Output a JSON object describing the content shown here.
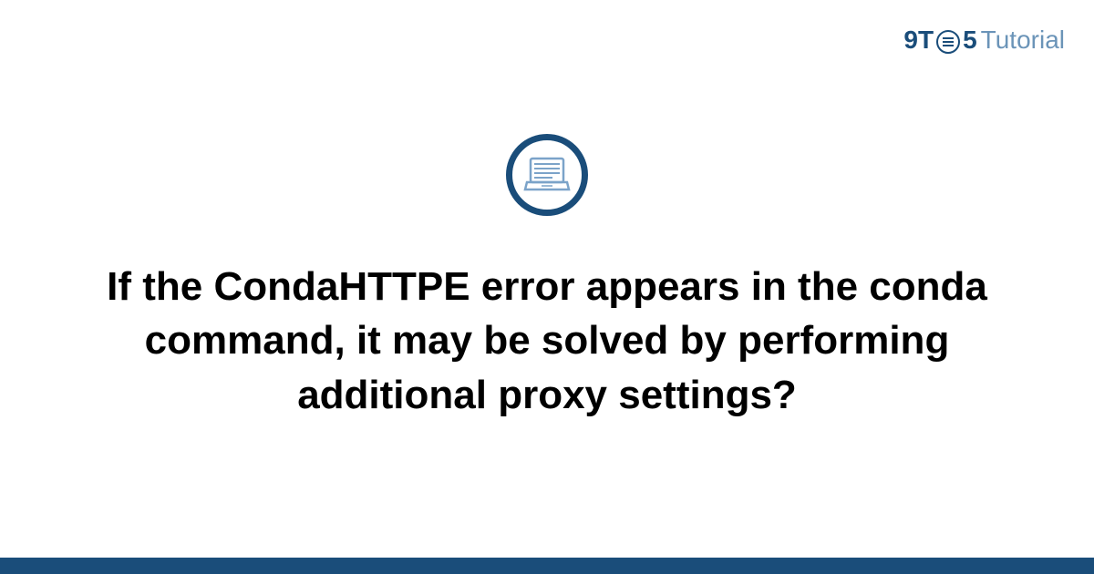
{
  "header": {
    "logo_prefix": "9T",
    "logo_suffix": "5",
    "logo_tutorial": "Tutorial"
  },
  "main": {
    "title": "If the CondaHTTPE error appears in the conda command, it may be solved by performing additional proxy settings?"
  }
}
